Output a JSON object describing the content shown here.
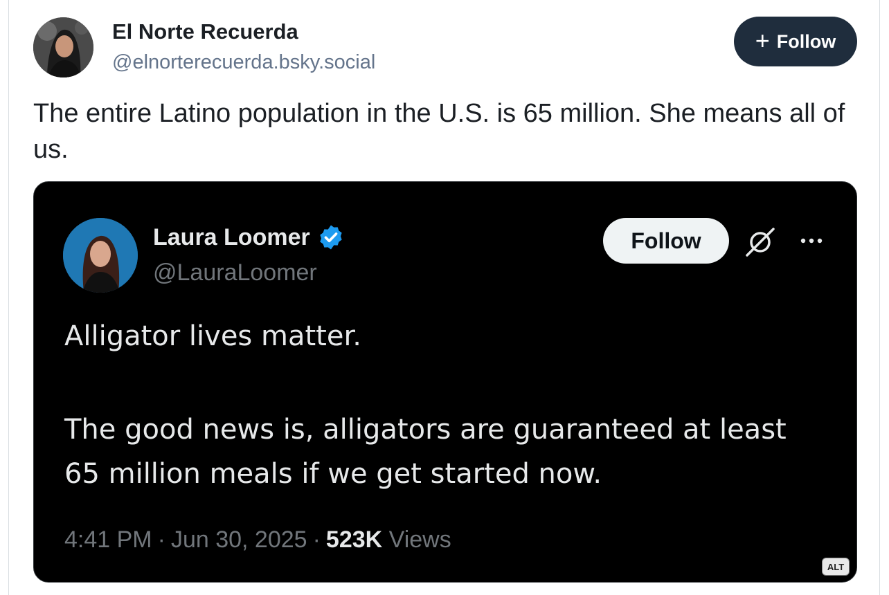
{
  "outer_post": {
    "display_name": "El Norte Recuerda",
    "handle": "@elnorterecuerda.bsky.social",
    "follow_label": "Follow",
    "follow_icon": "plus-icon",
    "text": "The entire Latino population in the U.S. is 65 million. She means all of us."
  },
  "embedded_post": {
    "display_name": "Laura Loomer",
    "verified_icon": "verified-badge-icon",
    "handle": "@LauraLoomer",
    "follow_label": "Follow",
    "text_line_1": "Alligator lives matter.",
    "text_line_2": "The good news is, alligators are guaranteed at least 65 million meals if we get started now.",
    "time": "4:41 PM",
    "separator": "·",
    "date": "Jun 30, 2025",
    "views_count": "523K",
    "views_label": "Views",
    "alt_badge": "ALT"
  },
  "colors": {
    "follow_button_bg": "#1f2d3d",
    "verified_blue": "#1d9bf0",
    "embed_bg": "#000000"
  }
}
